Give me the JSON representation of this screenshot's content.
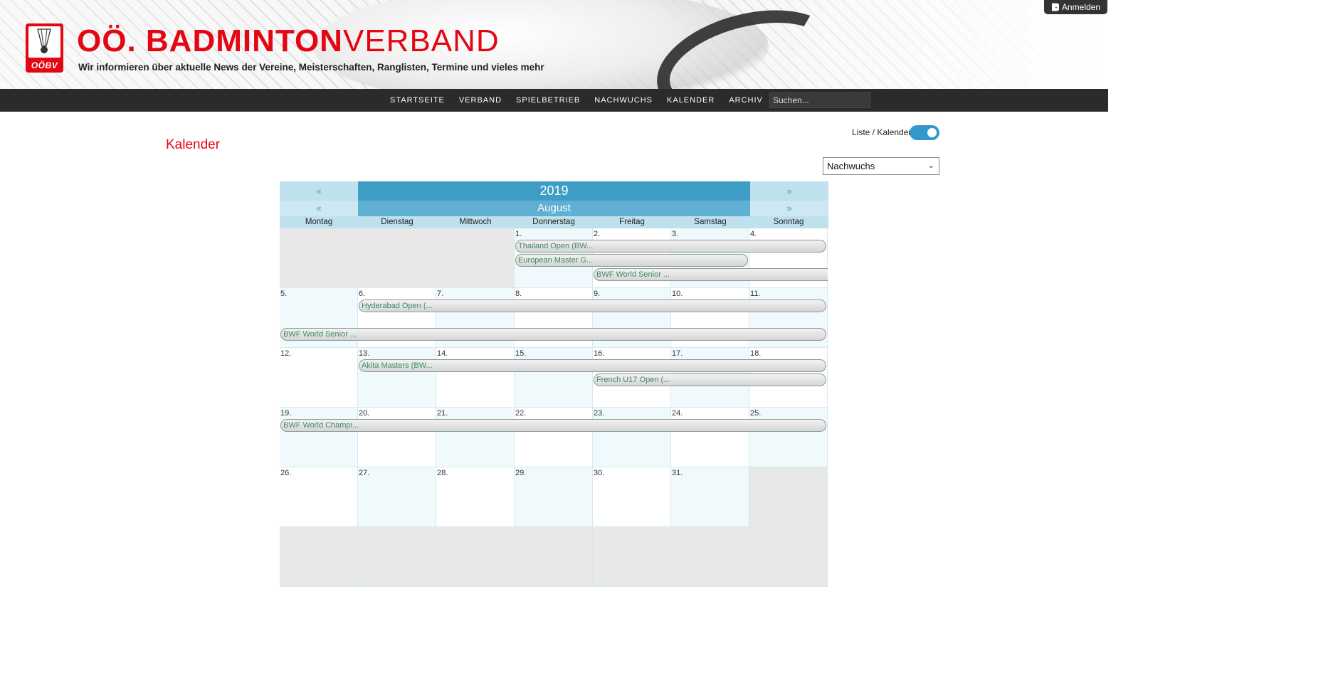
{
  "header": {
    "title_bold": "OÖ. BADMINTON",
    "title_light": "VERBAND",
    "subtitle": "Wir informieren über aktuelle News der Vereine, Meisterschaften, Ranglisten, Termine und vieles mehr",
    "logo_text": "OÖBV",
    "login_label": "Anmelden"
  },
  "nav": {
    "items": [
      "STARTSEITE",
      "VERBAND",
      "SPIELBETRIEB",
      "NACHWUCHS",
      "KALENDER",
      "ARCHIV"
    ],
    "search_placeholder": "Suchen..."
  },
  "page": {
    "title": "Kalender",
    "toggle_label": "Liste / Kalender",
    "toggle_on": true,
    "filter_selected": "Nachwuchs"
  },
  "calendar": {
    "year": "2019",
    "month": "August",
    "prev_symbol": "«",
    "next_symbol": "»",
    "weekdays": [
      "Montag",
      "Dienstag",
      "Mittwoch",
      "Donnerstag",
      "Freitag",
      "Samstag",
      "Sonntag"
    ],
    "weeks": [
      [
        "",
        "",
        "",
        "1.",
        "2.",
        "3.",
        "4."
      ],
      [
        "5.",
        "6.",
        "7.",
        "8.",
        "9.",
        "10.",
        "11."
      ],
      [
        "12.",
        "13.",
        "14.",
        "15.",
        "16.",
        "17.",
        "18."
      ],
      [
        "19.",
        "20.",
        "21.",
        "22.",
        "23.",
        "24.",
        "25."
      ],
      [
        "26.",
        "27.",
        "28.",
        "29.",
        "30.",
        "31.",
        ""
      ],
      [
        "",
        "",
        "",
        "",
        "",
        "",
        ""
      ]
    ],
    "events": [
      {
        "label": "Thailand Open (BW...",
        "week": 0,
        "start": 3,
        "end": 6,
        "lane": 0,
        "closed_end": true
      },
      {
        "label": "European Master G...",
        "week": 0,
        "start": 3,
        "end": 5,
        "lane": 1,
        "closed_end": true
      },
      {
        "label": "BWF World Senior ...",
        "week": 0,
        "start": 4,
        "end": 6,
        "lane": 2,
        "closed_end": false
      },
      {
        "label": "Hyderabad Open (...",
        "week": 1,
        "start": 1,
        "end": 6,
        "lane": 0,
        "closed_end": true
      },
      {
        "label": "BWF World Senior ...",
        "week": 1,
        "start": 0,
        "end": 6,
        "lane": 2,
        "closed_end": true
      },
      {
        "label": "Akita Masters (BW...",
        "week": 2,
        "start": 1,
        "end": 6,
        "lane": 0,
        "closed_end": true
      },
      {
        "label": "French U17 Open (...",
        "week": 2,
        "start": 4,
        "end": 6,
        "lane": 1,
        "closed_end": true
      },
      {
        "label": "BWF World Champi...",
        "week": 3,
        "start": 0,
        "end": 6,
        "lane": 0,
        "closed_end": true
      }
    ]
  }
}
